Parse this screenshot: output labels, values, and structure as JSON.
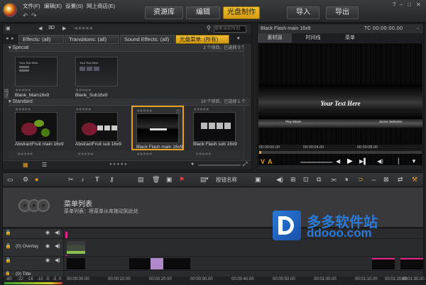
{
  "menu": {
    "file": "文件(F)",
    "edit": "编辑(E)",
    "settings": "设置(S)",
    "store": "网上商店(E)"
  },
  "nav": {
    "library": "资源库",
    "edit": "编辑",
    "disc": "光盘制作",
    "import": "导入",
    "export": "导出"
  },
  "library": {
    "mode": "3D",
    "stars": "★★★★★",
    "search_placeholder": "搜索当前所视",
    "tabs": [
      "Effects: (all)",
      "Transitions: (all)",
      "Sound Effects: (all)",
      "光盘菜单: (所有)"
    ],
    "side_label": "描述",
    "special": {
      "title": "Special",
      "count": "2 个项目，已选择 0 个",
      "items": [
        {
          "name": "Blank_Main16x9",
          "thumb_text": "Your Text Here"
        },
        {
          "name": "Blank_Sub16x9",
          "thumb_text": "Your Text Here"
        }
      ]
    },
    "standard": {
      "title": "Standard",
      "count": "18 个项目，已选择 1 个",
      "items": [
        {
          "name": "AbstractFruit main 16x9"
        },
        {
          "name": "AbstractFruit sub 16x9"
        },
        {
          "name": "Black Flash main 16x9"
        },
        {
          "name": "Black Flash sub 16x9"
        }
      ]
    },
    "dots": "● ● ● ● ●"
  },
  "preview": {
    "title": "Black Flash main 16x9",
    "tc": "TC",
    "timecode": "00:00:00.00",
    "tabs": [
      "素材源",
      "时间线",
      "菜单"
    ],
    "video_text": "Your Text Here",
    "btn_left": "Play Movie",
    "btn_right": "Scene Selection",
    "ruler": [
      "00:00:04.00",
      "00:00:08.00"
    ],
    "time_left": "00:00:00.00"
  },
  "timeline": {
    "menu_label": "菜单列表",
    "menu_hint": "菜单列表：将菜单从库拖动到此处",
    "button_name": "按钮名称",
    "tracks": [
      {
        "name": ""
      },
      {
        "name": "(0) Overlay"
      },
      {
        "name": ""
      },
      {
        "name": "(0) Title"
      }
    ],
    "ruler": [
      "-60",
      "-22",
      "-16",
      "-10",
      "-5",
      "-3",
      "0",
      "00:00:00.00",
      "00:00:10.00",
      "00:00:20.00",
      "00:00:30.00",
      "00:00:40.00",
      "00:00:50.00",
      "00:01:00.00",
      "00:01:10.00",
      "00:01:20.00",
      "00:01:30.00"
    ]
  },
  "watermark": {
    "text": "多多软件站",
    "url": "ddooo.com"
  },
  "colors": {
    "accent": "#e8b020",
    "active_text": "#1c1c1c",
    "overlay_clip": "#a0d060"
  }
}
